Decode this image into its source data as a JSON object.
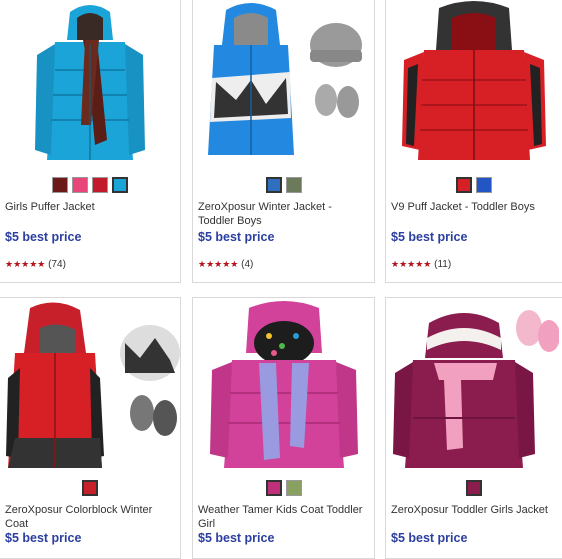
{
  "products": [
    {
      "name": "Girls Puffer Jacket",
      "price": "$5 best price",
      "rating_count": "(74)",
      "stars": "★★★★★",
      "swatch_colors": [
        "#6b1a18",
        "#e8457a",
        "#c21a2a",
        "#1aa4d8"
      ]
    },
    {
      "name": "ZeroXposur Winter Jacket - Toddler Boys",
      "price": "$5 best price",
      "rating_count": "(4)",
      "stars": "★★★★★",
      "swatch_colors": [
        "#2e6fbf",
        "#6b7a5a"
      ]
    },
    {
      "name": "V9 Puff Jacket - Toddler Boys",
      "price": "$5 best price",
      "rating_count": "(11)",
      "stars": "★★★★★",
      "swatch_colors": [
        "#d71f26",
        "#2356c4"
      ]
    },
    {
      "name": "ZeroXposur Colorblock Winter Coat",
      "price": "$5 best price",
      "swatch_colors": [
        "#c8202a"
      ]
    },
    {
      "name": "Weather Tamer Kids Coat Toddler Girl",
      "price": "$5 best price",
      "swatch_colors": [
        "#c0307a",
        "#8aa060"
      ]
    },
    {
      "name": "ZeroXposur Toddler Girls Jacket",
      "price": "$5 best price",
      "swatch_colors": [
        "#8a1c4e"
      ]
    }
  ]
}
